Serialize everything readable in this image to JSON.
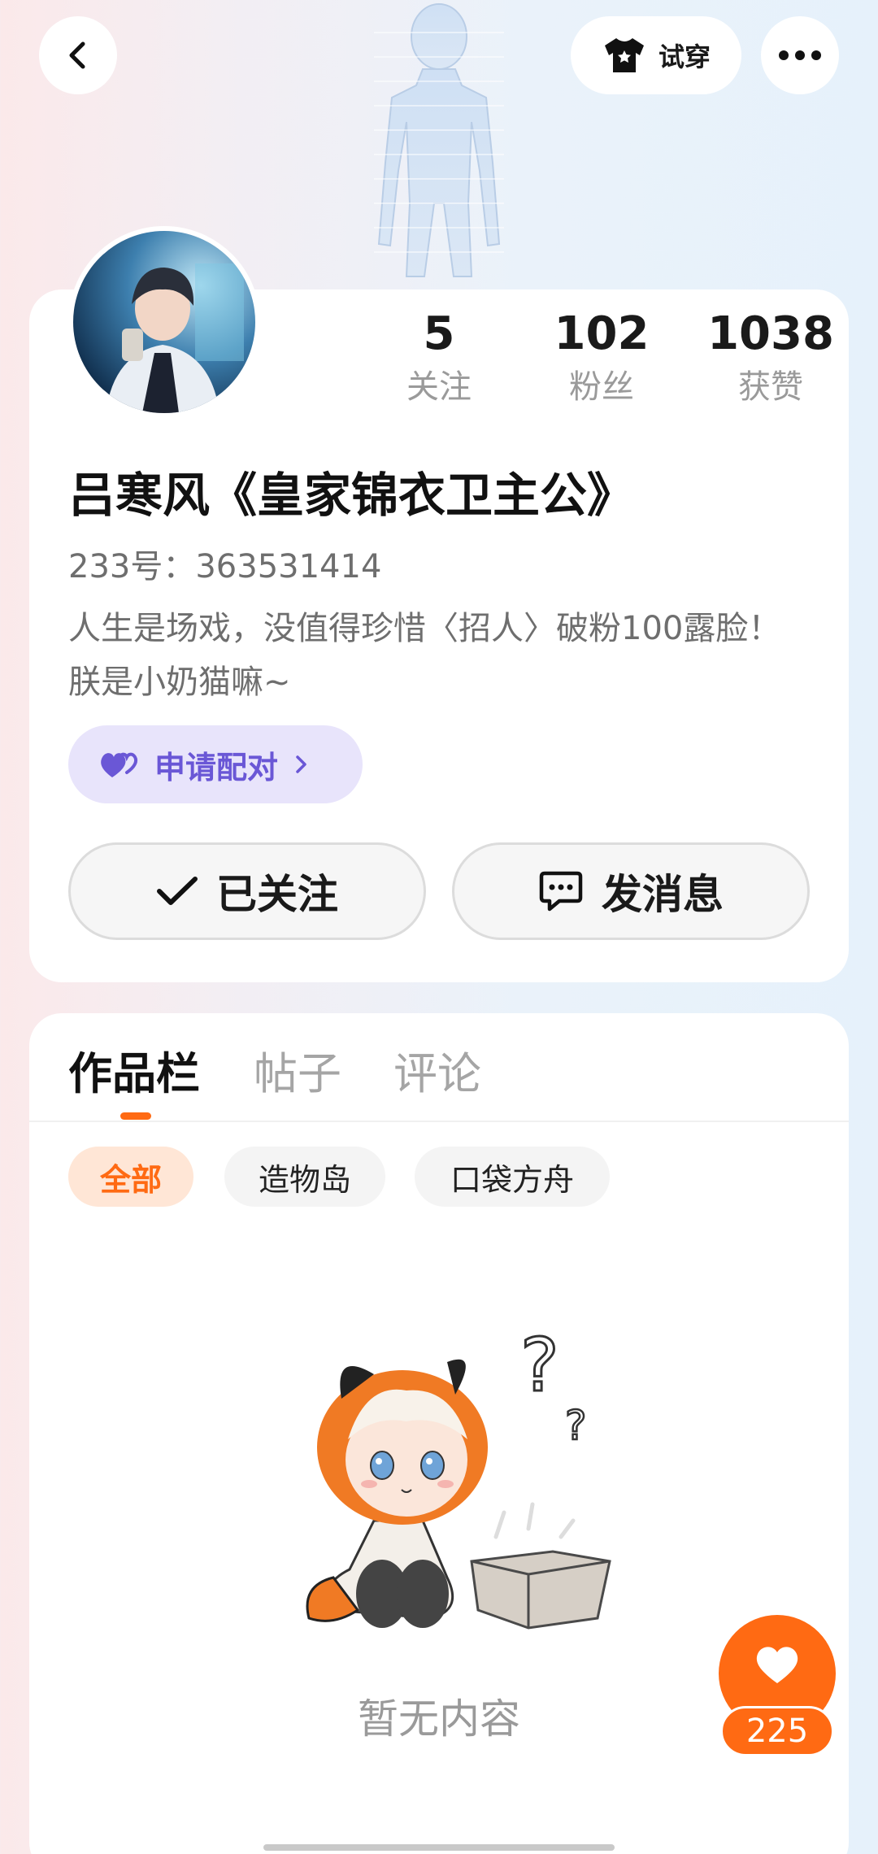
{
  "header": {
    "tryon_label": "试穿"
  },
  "profile": {
    "stats": [
      {
        "value": "5",
        "label": "关注"
      },
      {
        "value": "102",
        "label": "粉丝"
      },
      {
        "value": "1038",
        "label": "获赞"
      }
    ],
    "name": "吕寒风《皇家锦衣卫主公》",
    "uid": "233号：363531414",
    "bio": "人生是场戏，没值得珍惜〈招人〉破粉100露脸！朕是小奶猫嘛~",
    "pair_label": "申请配对",
    "follow_label": "已关注",
    "message_label": "发消息"
  },
  "tabs": [
    {
      "label": "作品栏",
      "active": true
    },
    {
      "label": "帖子",
      "active": false
    },
    {
      "label": "评论",
      "active": false
    }
  ],
  "filters": [
    {
      "label": "全部",
      "active": true
    },
    {
      "label": "造物岛",
      "active": false
    },
    {
      "label": "口袋方舟",
      "active": false
    }
  ],
  "empty_state": {
    "text": "暂无内容"
  },
  "like_button": {
    "count": "225"
  },
  "colors": {
    "accent": "#ff6a13",
    "pair_purple": "#6a57d6",
    "pair_bg": "#e8e4fb"
  }
}
